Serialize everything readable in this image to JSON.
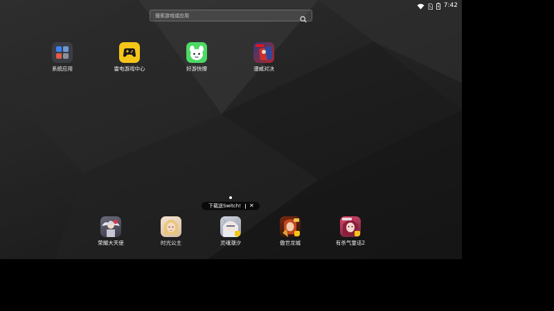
{
  "status_bar": {
    "time": "7:42",
    "icons": [
      "wifi-icon",
      "sim-icon",
      "battery-icon"
    ]
  },
  "search": {
    "placeholder": "搜索游戏或应用",
    "icon": "search-icon"
  },
  "top_apps": [
    {
      "label": "系统应用",
      "icon": "system-apps-folder-icon"
    },
    {
      "label": "雷电游戏中心",
      "icon": "ldplayer-game-center-icon"
    },
    {
      "label": "好游快爆",
      "icon": "haoyou-kuaibao-icon"
    },
    {
      "label": "漫威对决",
      "icon": "marvel-duel-icon"
    }
  ],
  "dock_apps": [
    {
      "label": "荣耀大天使",
      "icon": "glory-archangel-icon"
    },
    {
      "label": "时光公主",
      "icon": "time-princess-icon"
    },
    {
      "label": "灵魂潮汐",
      "icon": "soul-tide-icon"
    },
    {
      "label": "傲世龙城",
      "icon": "aoshi-longcheng-icon"
    },
    {
      "label": "有杀气童话2",
      "icon": "fairy-tale-2-icon"
    }
  ],
  "promo": {
    "text": "下载送Switch!",
    "close_label": "✕"
  },
  "colors": {
    "accent_yellow": "#f5c518",
    "accent_green": "#4cd964",
    "badge_yellow": "#f5c518"
  }
}
